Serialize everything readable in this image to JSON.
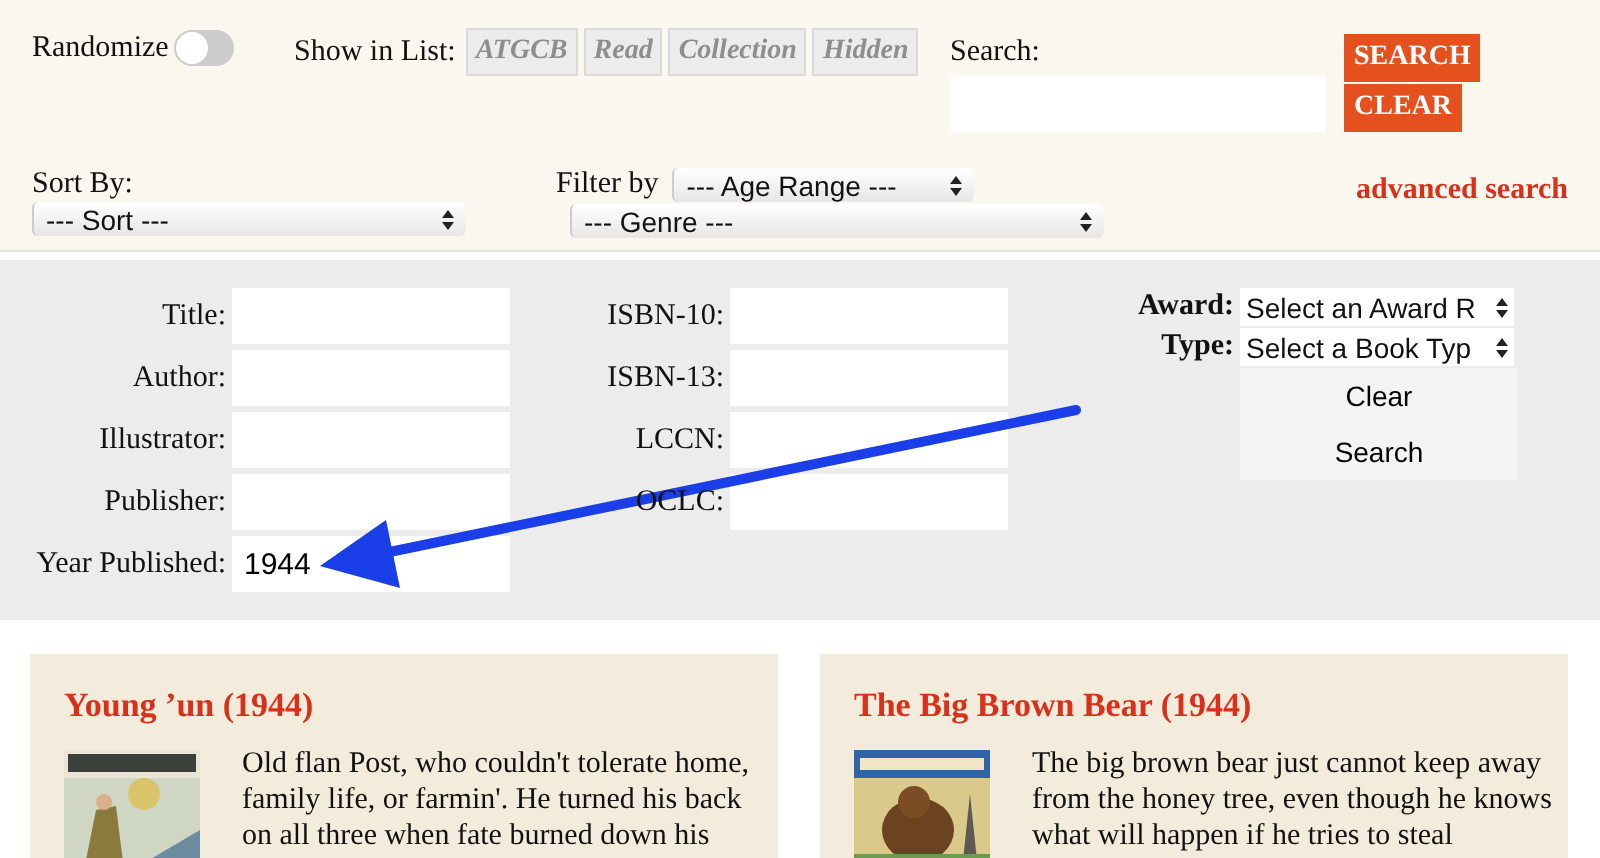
{
  "top_bar": {
    "randomize": {
      "label": "Randomize",
      "on": false
    },
    "show_in_list": {
      "label": "Show in List:",
      "options": [
        {
          "label": "ATGCB",
          "selected": false
        },
        {
          "label": "Read",
          "selected": false
        },
        {
          "label": "Collection",
          "selected": false
        },
        {
          "label": "Hidden",
          "selected": false
        }
      ]
    },
    "search": {
      "label": "Search:"
    },
    "buttons": [
      "SEARCH",
      "CLEAR"
    ],
    "sort": {
      "label": "Sort By:",
      "value": "--- Sort ---"
    },
    "filter": {
      "label": "Filter by",
      "age_range": "--- Age Range ---",
      "genre": "--- Genre ---"
    },
    "advanced_link": "advanced search"
  },
  "advanced_form": {
    "fields_left": [
      {
        "label": "Title:"
      },
      {
        "label": "Author:"
      },
      {
        "label": "Illustrator:"
      },
      {
        "label": "Publisher:"
      },
      {
        "label": "Year Published:",
        "value": "1944"
      }
    ],
    "fields_right": [
      {
        "label": "ISBN-10:"
      },
      {
        "label": "ISBN-13:"
      },
      {
        "label": "LCCN:"
      },
      {
        "label": "OCLC:"
      }
    ],
    "selects": [
      {
        "label": "Award:",
        "value": "Select an Award R"
      },
      {
        "label": "Type:",
        "value": "Select a Book Typ"
      }
    ],
    "buttons": [
      "Clear",
      "Search"
    ]
  },
  "results": [
    {
      "title": "Young ’un (1944)",
      "text": "Old flan Post, who couldn't tolerate home, family life, or farmin'. He turned his back on all three when fate burned down his"
    },
    {
      "title": "The Big Brown Bear (1944)",
      "text": "The big brown bear just cannot keep away from the honey tree, even though he knows what will happen if he tries to steal"
    }
  ]
}
